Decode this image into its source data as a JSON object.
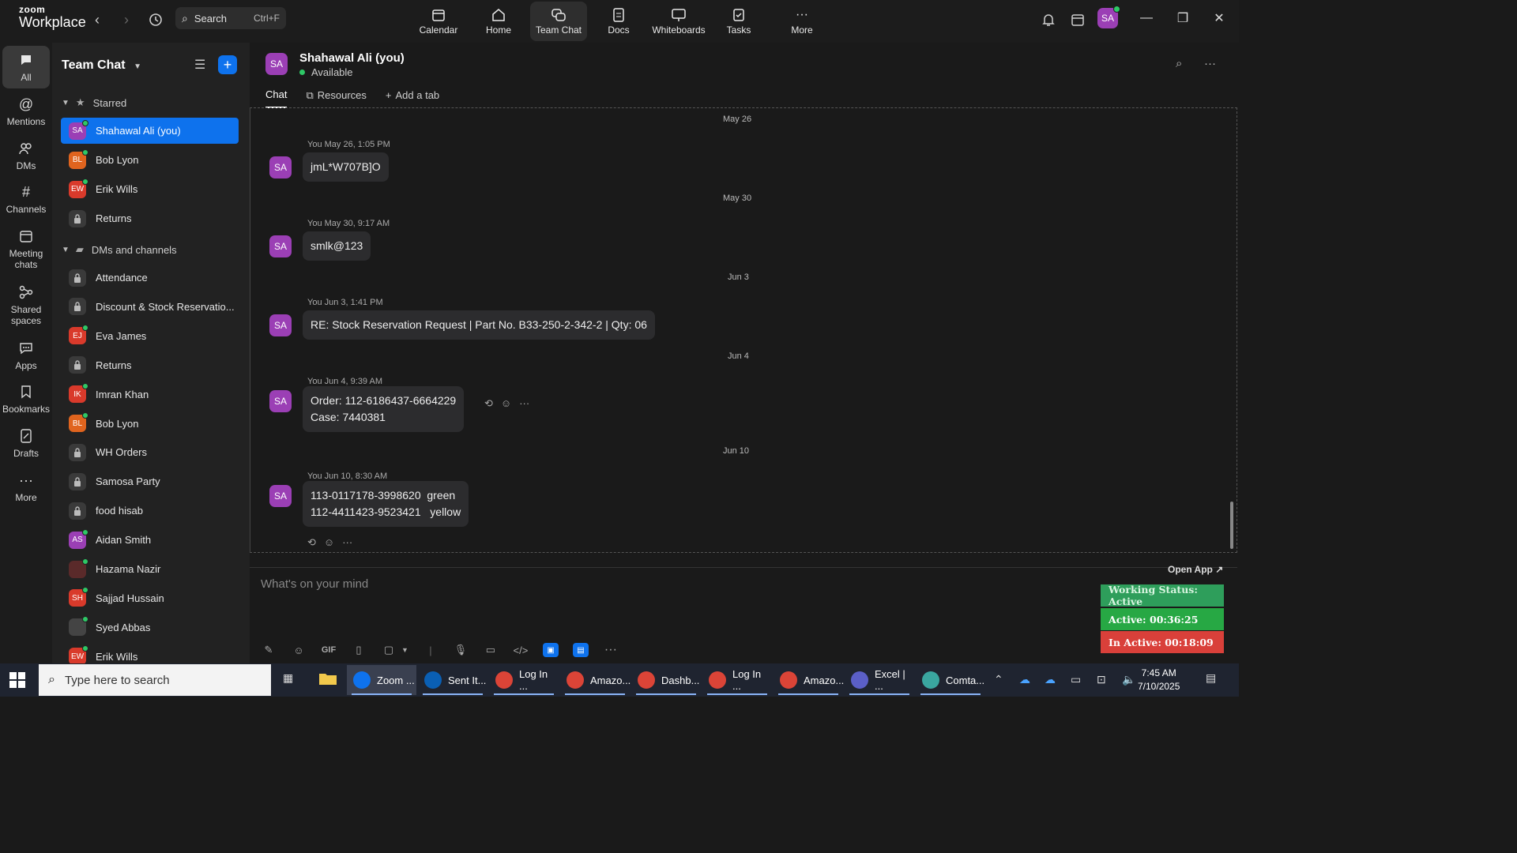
{
  "app": {
    "logo_top": "zoom",
    "logo_bottom": "Workplace",
    "search_label": "Search",
    "search_shortcut": "Ctrl+F",
    "avatar_initials": "SA"
  },
  "nav": {
    "calendar": "Calendar",
    "home": "Home",
    "team_chat": "Team Chat",
    "docs": "Docs",
    "whiteboards": "Whiteboards",
    "tasks": "Tasks",
    "more": "More"
  },
  "rail": {
    "all": "All",
    "mentions": "Mentions",
    "dms": "DMs",
    "channels": "Channels",
    "meeting_chats_1": "Meeting",
    "meeting_chats_2": "chats",
    "shared_spaces_1": "Shared",
    "shared_spaces_2": "spaces",
    "apps": "Apps",
    "bookmarks": "Bookmarks",
    "drafts": "Drafts",
    "more": "More"
  },
  "sidebar": {
    "title": "Team Chat",
    "starred_label": "Starred",
    "dms_channels_label": "DMs and channels",
    "starred": [
      {
        "label": "Shahawal Ali (you)",
        "initials": "SA",
        "color": "#9b3fb5"
      },
      {
        "label": "Bob Lyon",
        "initials": "BL",
        "color": "#e0641e"
      },
      {
        "label": "Erik Wills",
        "initials": "EW",
        "color": "#d93a2b"
      },
      {
        "label": "Returns",
        "initials": "",
        "color": ""
      }
    ],
    "items": [
      {
        "label": "Attendance",
        "initials": "",
        "color": ""
      },
      {
        "label": "Discount & Stock Reservatio...",
        "initials": "",
        "color": ""
      },
      {
        "label": "Eva James",
        "initials": "EJ",
        "color": "#d93a2b"
      },
      {
        "label": "Returns",
        "initials": "",
        "color": ""
      },
      {
        "label": "Imran Khan",
        "initials": "IK",
        "color": "#d93a2b"
      },
      {
        "label": "Bob Lyon",
        "initials": "BL",
        "color": "#e0641e"
      },
      {
        "label": "WH Orders",
        "initials": "",
        "color": ""
      },
      {
        "label": "Samosa Party",
        "initials": "",
        "color": ""
      },
      {
        "label": "food hisab",
        "initials": "",
        "color": ""
      },
      {
        "label": "Aidan Smith",
        "initials": "AS",
        "color": "#9b3fb5"
      },
      {
        "label": "Hazama Nazir",
        "initials": "",
        "color": "#5a2a2a"
      },
      {
        "label": "Sajjad Hussain",
        "initials": "SH",
        "color": "#d93a2b"
      },
      {
        "label": "Syed Abbas",
        "initials": "",
        "color": "#444"
      },
      {
        "label": "Erik Wills",
        "initials": "EW",
        "color": "#d93a2b"
      }
    ]
  },
  "chat": {
    "avatar": "SA",
    "name": "Shahawal Ali (you)",
    "status": "Available",
    "tabs": {
      "chat": "Chat",
      "resources": "Resources",
      "add_tab": "Add a tab"
    },
    "messages": [
      {
        "date": "May 26",
        "meta": "You May 26, 1:05 PM",
        "text": "jmL*W707B]O"
      },
      {
        "date": "May 30",
        "meta": "You May 30, 9:17 AM",
        "text": "smlk@123"
      },
      {
        "date": "Jun 3",
        "meta": "You Jun 3, 1:41 PM",
        "text": "RE: Stock Reservation Request | Part No. B33-250-2-342-2 | Qty: 06"
      },
      {
        "date": "Jun 4",
        "meta": "You Jun 4, 9:39 AM",
        "text": "Order: 112-6186437-6664229\nCase: 7440381"
      },
      {
        "date": "Jun 10",
        "meta": "You Jun 10, 8:30 AM",
        "text": "113-0117178-3998620  green\n112-4411423-9523421   yellow"
      }
    ],
    "composer_placeholder": "What's on your mind",
    "gif_label": "GIF"
  },
  "widget": {
    "open_app": "Open App ↗",
    "working_status": "Working Status: Active",
    "active": "Active: 00:36:25",
    "inactive": "In Active: 00:18:09",
    "colors": {
      "working": "#2e9e5b",
      "active": "#27a844",
      "inactive": "#d9403a"
    }
  },
  "taskbar": {
    "search_placeholder": "Type here to search",
    "apps": [
      {
        "label": "Zoom ...",
        "color": "#0e72ed"
      },
      {
        "label": "Sent It...",
        "color": "#0a5fb4"
      },
      {
        "label": "Log In ...",
        "color": "#db4437"
      },
      {
        "label": "Amazo...",
        "color": "#db4437"
      },
      {
        "label": "Dashb...",
        "color": "#db4437"
      },
      {
        "label": "Log In ...",
        "color": "#db4437"
      },
      {
        "label": "Amazo...",
        "color": "#db4437"
      },
      {
        "label": "Excel | ...",
        "color": "#5b5fc7"
      },
      {
        "label": "Comta...",
        "color": "#3aa6a0"
      }
    ],
    "time": "7:45 AM",
    "date": "7/10/2025"
  }
}
